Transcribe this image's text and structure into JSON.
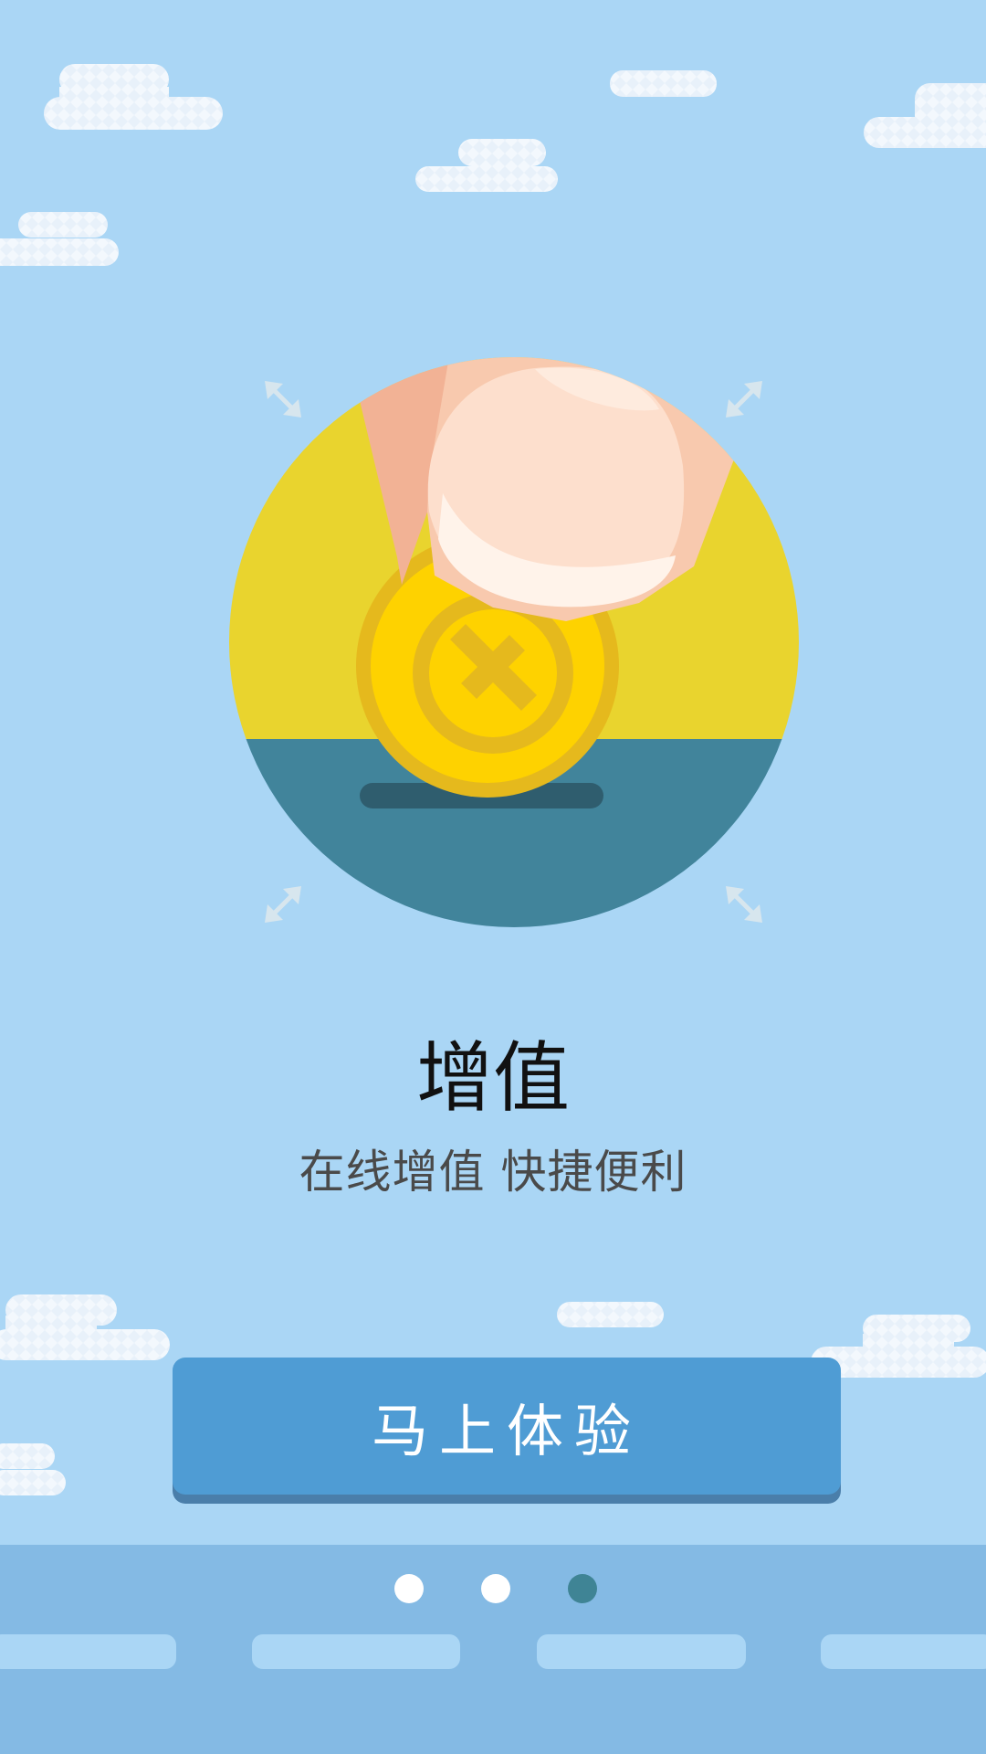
{
  "colors": {
    "background": "#aad6f5",
    "circle_top": "#e9d42e",
    "circle_bottom": "#41849b",
    "coin": "#fed200",
    "coin_rim": "#e5b91d",
    "button": "#4f9cd4",
    "footer": "#84bae4",
    "active_dot": "#3f8495"
  },
  "illustration": {
    "icon": "coin-into-piggy-slot-icon"
  },
  "content": {
    "title": "增值",
    "subtitle": "在线增值 快捷便利"
  },
  "cta": {
    "label": "马上体验"
  },
  "pager": {
    "page_count": 3,
    "active_index": 2
  }
}
